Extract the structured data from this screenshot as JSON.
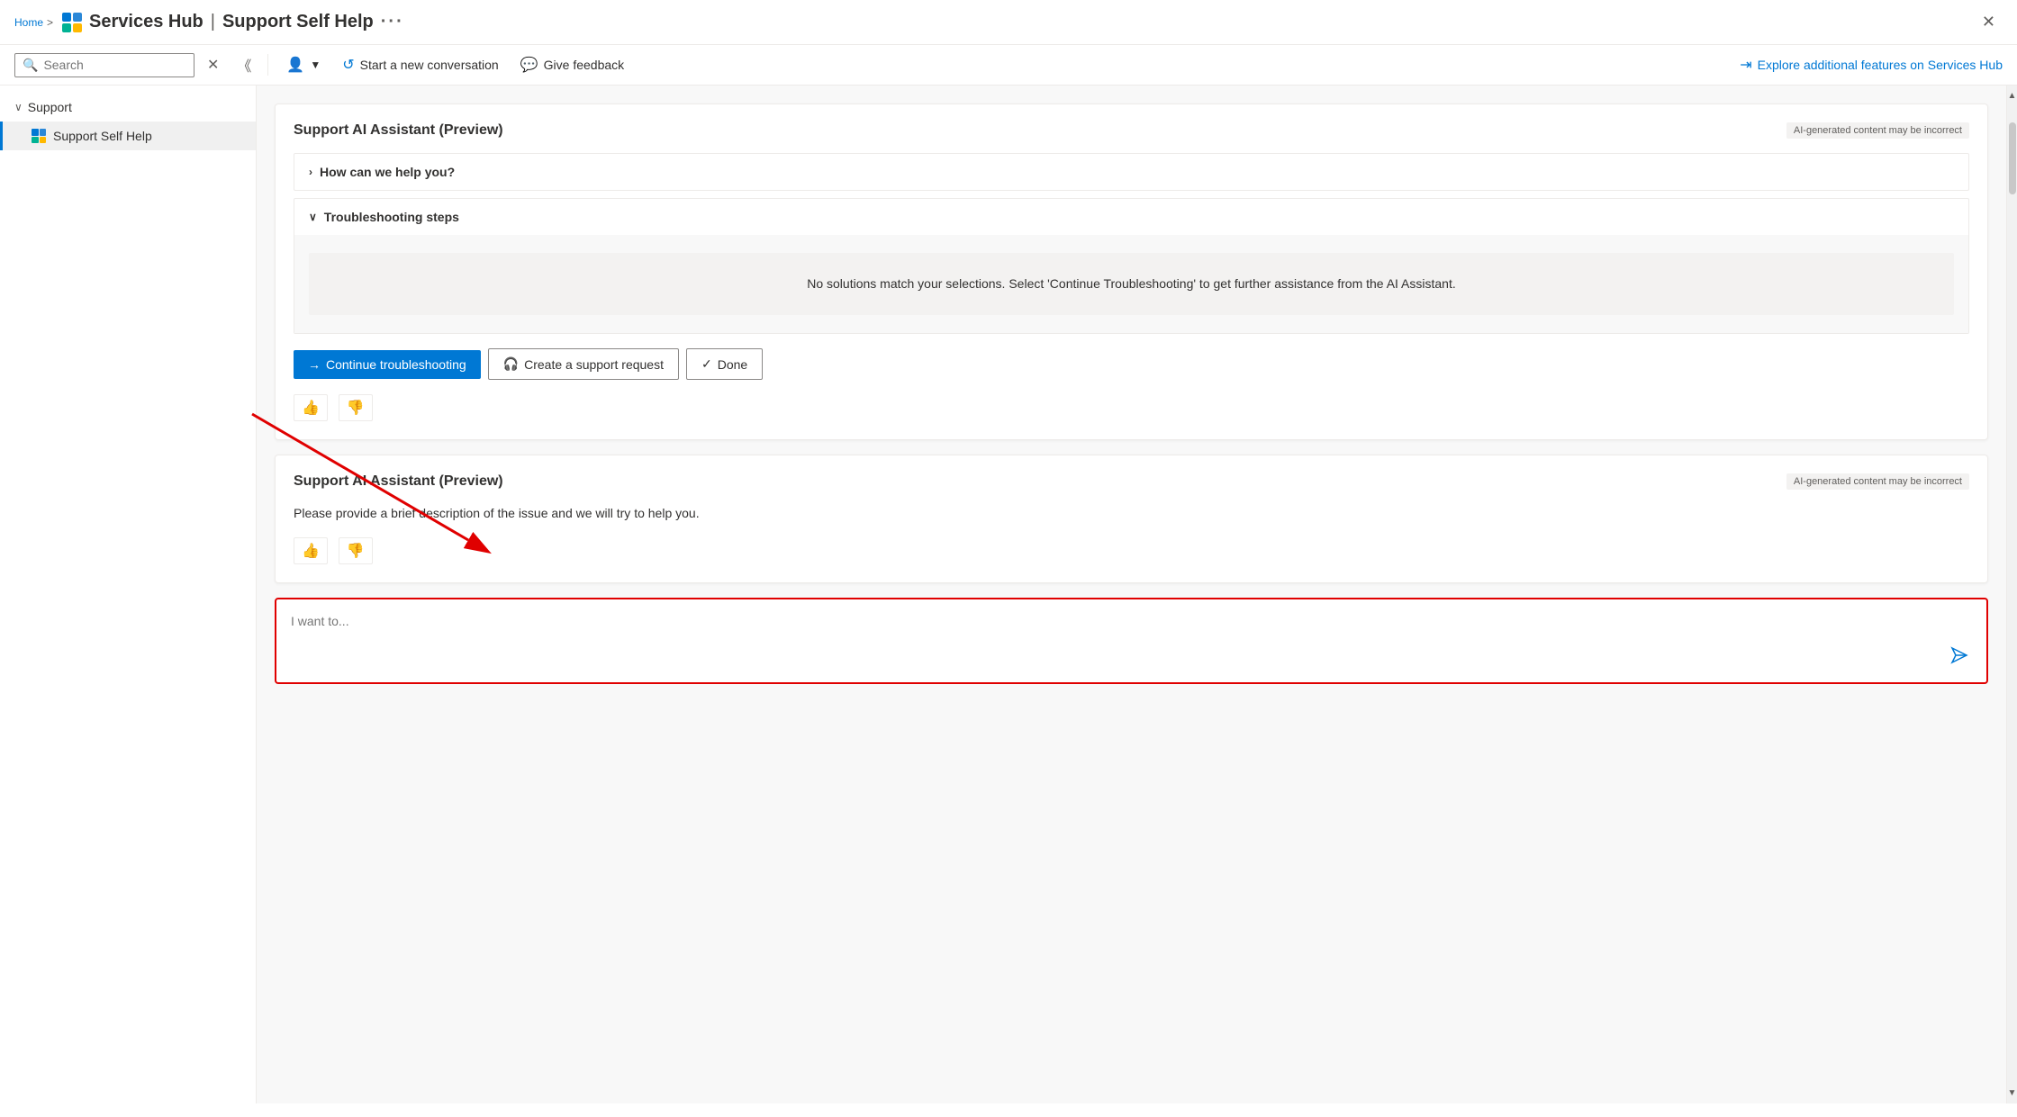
{
  "breadcrumb": {
    "home": "Home",
    "separator": ">"
  },
  "titleBar": {
    "appName": "Services Hub",
    "divider": "|",
    "section": "Support Self Help",
    "dots": "···",
    "close": "✕"
  },
  "toolbar": {
    "searchPlaceholder": "Search",
    "clearBtn": "✕",
    "chevronBtn": "˅",
    "newConversation": "Start a new conversation",
    "giveFeedback": "Give feedback",
    "exploreLink": "Explore additional features on Services Hub"
  },
  "sidebar": {
    "groupLabel": "Support",
    "activeItem": "Support Self Help"
  },
  "card1": {
    "title": "Support AI Assistant (Preview)",
    "aiBadge": "AI-generated content may be incorrect",
    "section1Label": "How can we help you?",
    "section1Collapsed": true,
    "section2Label": "Troubleshooting steps",
    "section2Expanded": true,
    "noSolutionsMsg": "No solutions match your selections. Select 'Continue Troubleshooting' to get further assistance from the AI Assistant.",
    "btnContinue": "Continue troubleshooting",
    "btnSupportRequest": "Create a support request",
    "btnDone": "Done"
  },
  "card2": {
    "title": "Support AI Assistant (Preview)",
    "aiBadge": "AI-generated content may be incorrect",
    "description": "Please provide a brief description of the issue and we will try to help you."
  },
  "inputBox": {
    "placeholder": "I want to..."
  }
}
